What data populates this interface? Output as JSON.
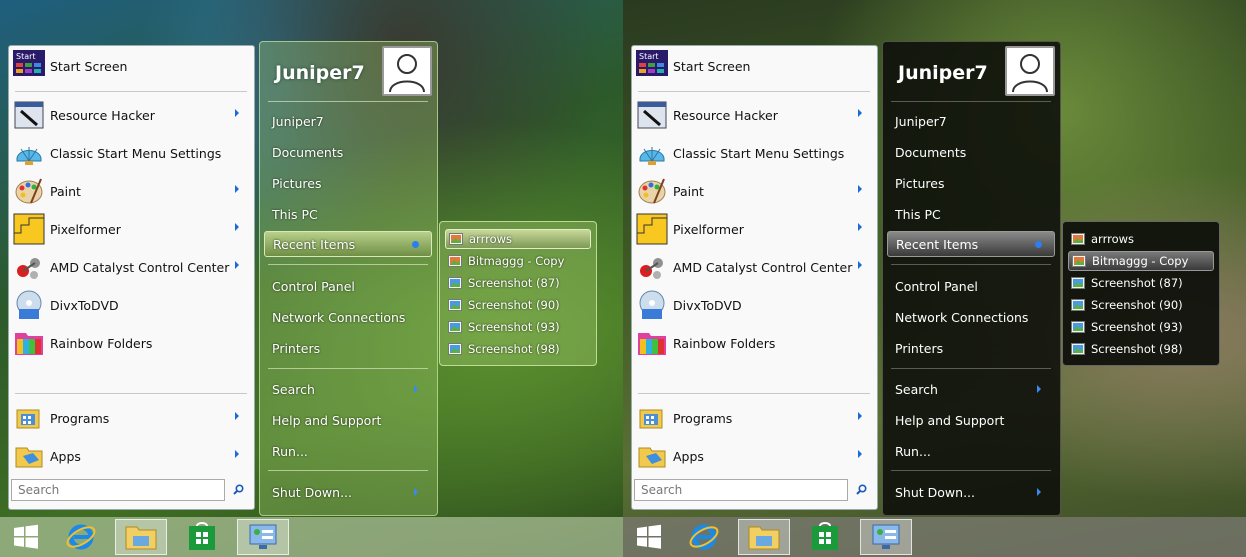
{
  "left_items": [
    {
      "label": "Start Screen",
      "icon": "start-screen-icon",
      "arrow": false
    },
    {
      "label": "Resource Hacker",
      "icon": "resource-hacker-icon",
      "arrow": true
    },
    {
      "label": "Classic Start Menu Settings",
      "icon": "shell-icon",
      "arrow": false
    },
    {
      "label": "Paint",
      "icon": "paint-palette-icon",
      "arrow": true
    },
    {
      "label": "Pixelformer",
      "icon": "pixelformer-icon",
      "arrow": true
    },
    {
      "label": "AMD Catalyst Control Center",
      "icon": "amd-catalyst-icon",
      "arrow": true
    },
    {
      "label": "DivxToDVD",
      "icon": "divx-dvd-icon",
      "arrow": false
    },
    {
      "label": "Rainbow Folders",
      "icon": "rainbow-folders-icon",
      "arrow": false
    }
  ],
  "programs_label": "Programs",
  "apps_label": "Apps",
  "search_placeholder": "Search",
  "username": "Juniper7",
  "right_items": {
    "juniper7": "Juniper7",
    "documents": "Documents",
    "pictures": "Pictures",
    "this_pc": "This PC",
    "recent_items": "Recent Items",
    "control_panel": "Control Panel",
    "network_connections": "Network Connections",
    "printers": "Printers",
    "search": "Search",
    "help_support": "Help and Support",
    "run": "Run...",
    "shut_down": "Shut Down..."
  },
  "recent_flyout": [
    "arrrows",
    "Bitmaggg - Copy",
    "Screenshot (87)",
    "Screenshot (90)",
    "Screenshot (93)",
    "Screenshot (98)"
  ],
  "start_tile_text": "Start",
  "colors": {
    "accent": "#1a6ad8",
    "store_green": "#1a9a3a"
  }
}
